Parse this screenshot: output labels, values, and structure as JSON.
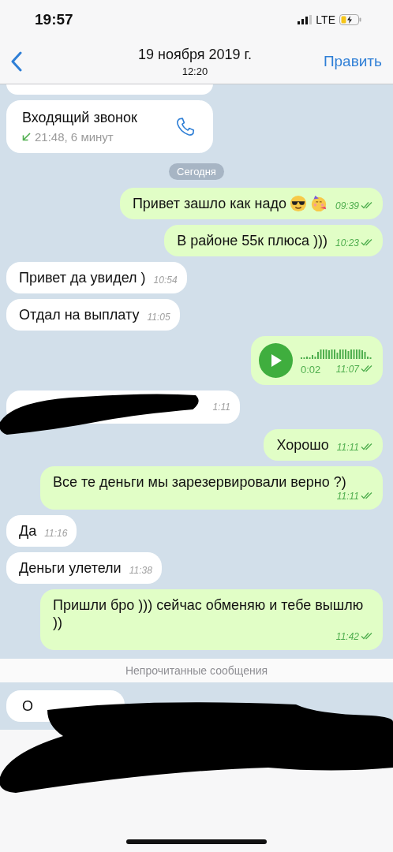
{
  "status_bar": {
    "time": "19:57",
    "network": "LTE",
    "charging": true
  },
  "header": {
    "title": "19 ноября 2019 г.",
    "subtitle": "12:20",
    "action": "Править"
  },
  "messages": [
    {
      "kind": "partial",
      "outgoing": false
    },
    {
      "kind": "call",
      "outgoing": false,
      "title": "Входящий звонок",
      "detail": "21:48, 6 минут"
    },
    {
      "kind": "date",
      "text": "Сегодня"
    },
    {
      "kind": "text",
      "outgoing": true,
      "text": "Привет зашло как надо",
      "icons": [
        {
          "kind": "sunglasses"
        },
        {
          "kind": "party"
        }
      ],
      "time": "09:39",
      "read": true
    },
    {
      "kind": "text",
      "outgoing": true,
      "text": "В районе 55к плюса )))",
      "time": "10:23",
      "read": true
    },
    {
      "kind": "text",
      "outgoing": false,
      "text": "Привет да увидел )",
      "time": "10:54"
    },
    {
      "kind": "text",
      "outgoing": false,
      "text": "Отдал на выплату",
      "time": "11:05"
    },
    {
      "kind": "voice",
      "outgoing": true,
      "duration": "0:02",
      "time": "11:07",
      "read": true
    },
    {
      "kind": "redacted",
      "outgoing": false,
      "time": "1:11"
    },
    {
      "kind": "text",
      "outgoing": true,
      "text": "Хорошо",
      "time": "11:11",
      "read": true
    },
    {
      "kind": "text",
      "outgoing": true,
      "text": "Все те деньги мы зарезервировали верно ?)",
      "time": "11:11",
      "read": true
    },
    {
      "kind": "text",
      "outgoing": false,
      "text": "Да",
      "time": "11:16"
    },
    {
      "kind": "text",
      "outgoing": false,
      "text": "Деньги улетели",
      "time": "11:38"
    },
    {
      "kind": "text",
      "outgoing": true,
      "text": "Пришли бро ))) сейчас обменяю и тебе вышлю ))",
      "time": "11:42",
      "read": true
    },
    {
      "kind": "unread",
      "text": "Непрочитанные сообщения"
    },
    {
      "kind": "redacted",
      "outgoing": false,
      "text": "О"
    }
  ]
}
